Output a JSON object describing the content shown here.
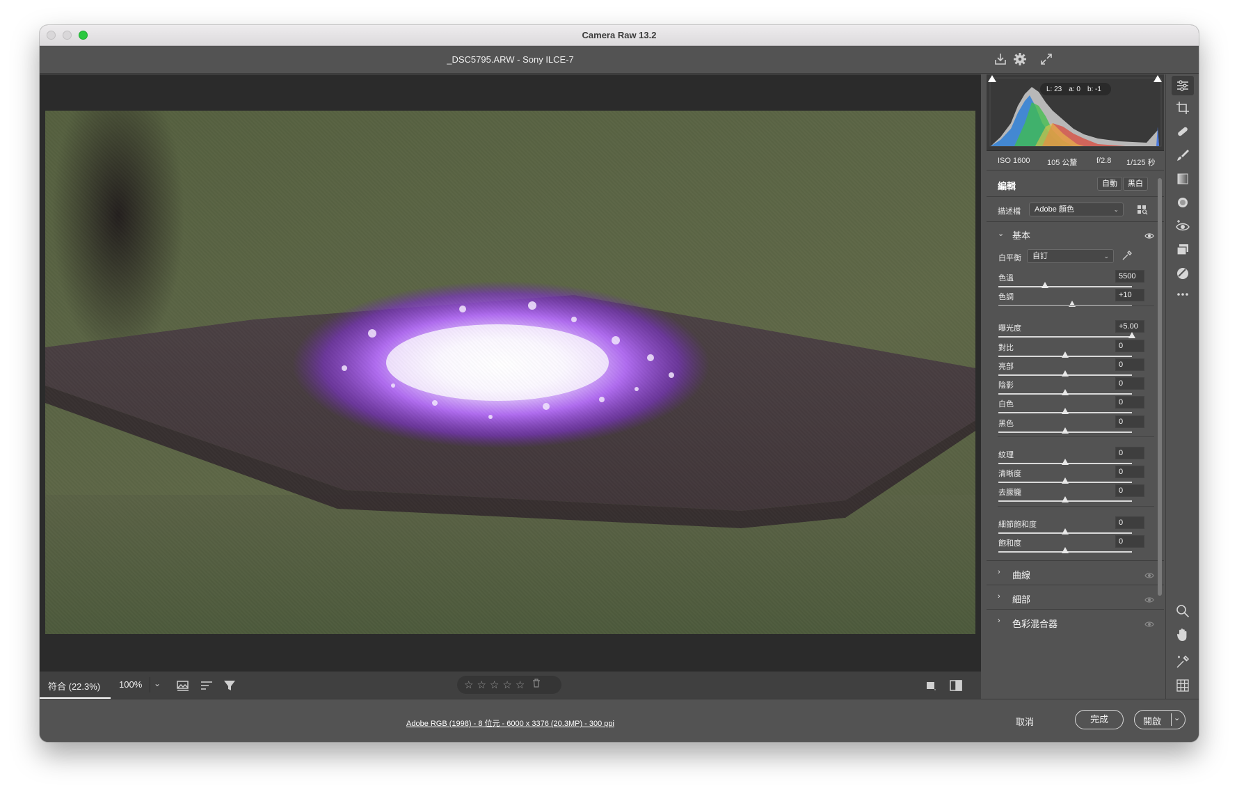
{
  "window": {
    "title": "Camera Raw 13.2"
  },
  "header": {
    "file_title": "_DSC5795.ARW  -  Sony ILCE-7"
  },
  "viewer": {
    "zoom_fit": "符合 (22.3%)",
    "zoom_100": "100%",
    "rating_stars": [
      "☆",
      "☆",
      "☆",
      "☆",
      "☆"
    ]
  },
  "footer": {
    "workflow_link": "Adobe RGB (1998) - 8 位元 - 6000 x 3376 (20.3MP) - 300 ppi",
    "cancel_label": "取消",
    "done_label": "完成",
    "open_label": "開啟"
  },
  "histogram": {
    "readout": {
      "l": "L: 23",
      "a": "a: 0",
      "b": "b: -1"
    }
  },
  "meta": {
    "iso": "ISO 1600",
    "focal": "105 公釐",
    "aperture": "f/2.8",
    "shutter": "1/125 秒"
  },
  "edit": {
    "title": "編輯",
    "auto_label": "自動",
    "bw_label": "黑白",
    "profile_label": "描述檔",
    "profile_value": "Adobe 顏色",
    "basic_label": "基本",
    "wb_label": "白平衡",
    "wb_value": "自訂"
  },
  "sliders": {
    "temp": {
      "name": "色溫",
      "value": "5500",
      "position": 0.35
    },
    "tint": {
      "name": "色調",
      "value": "+10",
      "position": 0.55
    },
    "exposure": {
      "name": "曝光度",
      "value": "+5.00",
      "position": 1.0
    },
    "contrast": {
      "name": "對比",
      "value": "0",
      "position": 0.5
    },
    "highlights": {
      "name": "亮部",
      "value": "0",
      "position": 0.5
    },
    "shadows": {
      "name": "陰影",
      "value": "0",
      "position": 0.5
    },
    "whites": {
      "name": "白色",
      "value": "0",
      "position": 0.5
    },
    "blacks": {
      "name": "黑色",
      "value": "0",
      "position": 0.5
    },
    "texture": {
      "name": "紋理",
      "value": "0",
      "position": 0.5
    },
    "clarity": {
      "name": "清晰度",
      "value": "0",
      "position": 0.5
    },
    "dehaze": {
      "name": "去朦朧",
      "value": "0",
      "position": 0.5
    },
    "vibrance": {
      "name": "細節飽和度",
      "value": "0",
      "position": 0.5
    },
    "saturation": {
      "name": "飽和度",
      "value": "0",
      "position": 0.5
    }
  },
  "sections": {
    "curve": "曲線",
    "detail": "細部",
    "mixer": "色彩混合器"
  },
  "colors": {
    "panel_bg": "#535353",
    "viewer_bg": "#2b2b2b",
    "accent_green": "#2bc840"
  }
}
